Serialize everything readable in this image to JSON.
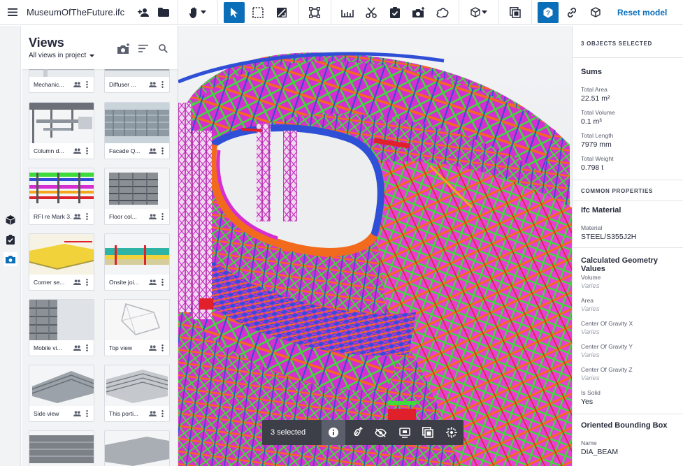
{
  "app": {
    "file_title": "MuseumOfTheFuture.ifc"
  },
  "toolbar": {
    "reset_label": "Reset model"
  },
  "views": {
    "title": "Views",
    "filter_label": "All views in project",
    "items": [
      {
        "name": "Mechanic..."
      },
      {
        "name": "Diffuser ..."
      },
      {
        "name": "Column d..."
      },
      {
        "name": "Facade Q..."
      },
      {
        "name": "RFI re Mark 3..."
      },
      {
        "name": "Floor col..."
      },
      {
        "name": "Corner se..."
      },
      {
        "name": "Onsite joi..."
      },
      {
        "name": "Mobile vi..."
      },
      {
        "name": "Top view"
      },
      {
        "name": "Side view"
      },
      {
        "name": "This porti..."
      }
    ]
  },
  "selection_bar": {
    "label": "3 selected"
  },
  "properties": {
    "header": "3 OBJECTS SELECTED",
    "sums": {
      "title": "Sums",
      "fields": [
        {
          "label": "Total Area",
          "value": "22.51 m²"
        },
        {
          "label": "Total Volume",
          "value": "0.1 m³"
        },
        {
          "label": "Total Length",
          "value": "7979 mm"
        },
        {
          "label": "Total Weight",
          "value": "0.798 t"
        }
      ]
    },
    "common_header": "COMMON PROPERTIES",
    "ifc_material": {
      "title": "Ifc Material",
      "fields": [
        {
          "label": "Material",
          "value": "STEEL/S355J2H"
        }
      ]
    },
    "calc_geometry": {
      "title": "Calculated Geometry Values",
      "fields": [
        {
          "label": "Volume",
          "value": "Varies"
        },
        {
          "label": "Area",
          "value": "Varies"
        },
        {
          "label": "Center Of Gravity X",
          "value": "Varies"
        },
        {
          "label": "Center Of Gravity Y",
          "value": "Varies"
        },
        {
          "label": "Center Of Gravity Z",
          "value": "Varies"
        },
        {
          "label": "Is Solid",
          "value": "Yes"
        }
      ]
    },
    "bounding_box": {
      "title": "Oriented Bounding Box",
      "fields": [
        {
          "label": "Name",
          "value": "DIA_BEAM"
        }
      ]
    }
  },
  "colors": {
    "accent": "#0a6eb8",
    "steel_orange": "#f26b1d",
    "steel_magenta": "#d62fd1",
    "steel_green": "#3ddc3a",
    "steel_blue": "#2f4fd6",
    "steel_red": "#e0202a"
  }
}
